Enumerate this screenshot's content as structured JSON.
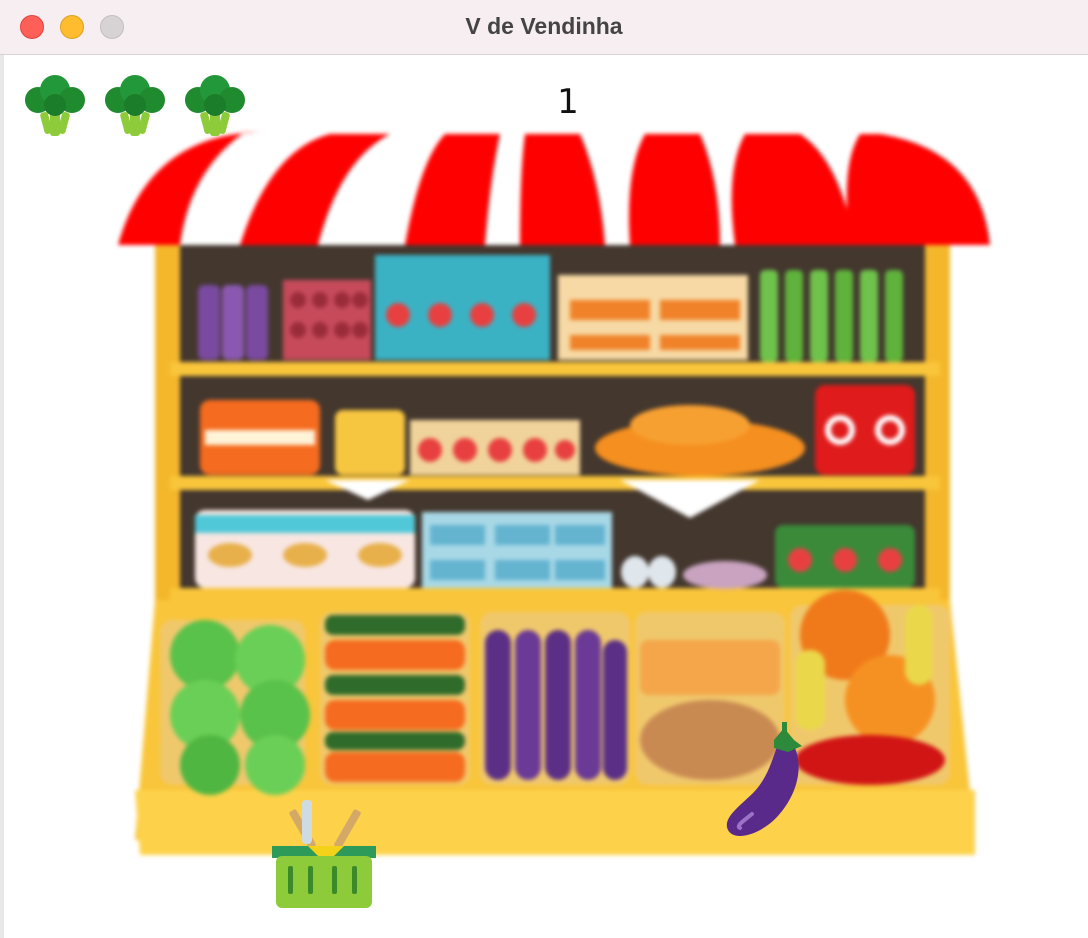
{
  "window": {
    "title": "V de Vendinha"
  },
  "hud": {
    "score": "1",
    "lives": 3,
    "life_icon": "broccoli-icon"
  },
  "scene": {
    "background": "market-stall",
    "awning_colors": [
      "#ff0000",
      "#ffffff"
    ],
    "shelf_color": "#f9c53a"
  },
  "sprites": {
    "player": "basket-icon",
    "falling_item": "eggplant-icon"
  }
}
